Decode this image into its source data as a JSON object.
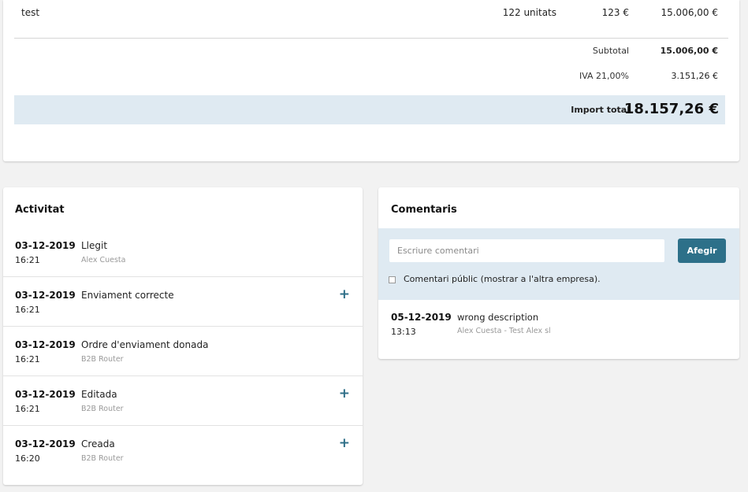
{
  "invoice": {
    "line": {
      "description": "test",
      "quantity": "122 unitats",
      "unit_price": "123 €",
      "total": "15.006,00 €"
    },
    "subtotal": {
      "label": "Subtotal",
      "value": "15.006,00 €"
    },
    "tax": {
      "label": "IVA 21,00%",
      "value": "3.151,26 €"
    },
    "grand_total": {
      "label": "Import total",
      "value": "18.157,26 €"
    }
  },
  "activity": {
    "title": "Activitat",
    "items": [
      {
        "date": "03-12-2019",
        "time": "16:21",
        "title": "Llegit",
        "user": "Alex Cuesta",
        "expandable": false
      },
      {
        "date": "03-12-2019",
        "time": "16:21",
        "title": "Enviament correcte",
        "user": "",
        "expandable": true
      },
      {
        "date": "03-12-2019",
        "time": "16:21",
        "title": "Ordre d'enviament donada",
        "user": "B2B Router",
        "expandable": false
      },
      {
        "date": "03-12-2019",
        "time": "16:21",
        "title": "Editada",
        "user": "B2B Router",
        "expandable": true
      },
      {
        "date": "03-12-2019",
        "time": "16:20",
        "title": "Creada",
        "user": "B2B Router",
        "expandable": true
      }
    ],
    "expand_symbol": "+"
  },
  "comments": {
    "title": "Comentaris",
    "input_placeholder": "Escriure comentari",
    "input_value": "",
    "add_button": "Afegir",
    "public_label": "Comentari públic (mostrar a l'altra empresa).",
    "public_checked": false,
    "entries": [
      {
        "date": "05-12-2019",
        "time": "13:13",
        "text": "wrong description",
        "author": "Alex Cuesta - Test Alex sl"
      }
    ]
  },
  "colors": {
    "accent": "#2d7089",
    "highlight_bg": "#dfeaf2",
    "muted_text": "#999999"
  }
}
